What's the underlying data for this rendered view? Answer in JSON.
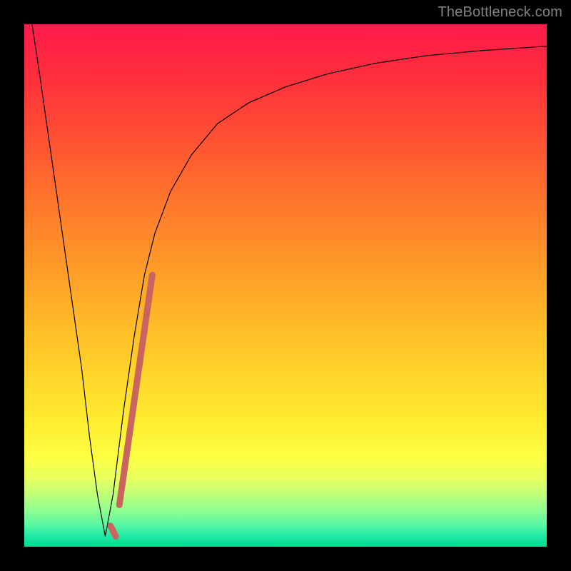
{
  "watermark": "TheBottleneck.com",
  "chart_data": {
    "type": "line",
    "title": "",
    "xlabel": "",
    "ylabel": "",
    "xlim": [
      0,
      100
    ],
    "ylim": [
      0,
      100
    ],
    "grid": false,
    "legend": false,
    "background_gradient": {
      "orientation": "vertical",
      "stops": [
        {
          "pos": 0.0,
          "color": "#ff1a4b"
        },
        {
          "pos": 0.08,
          "color": "#ff2a3f"
        },
        {
          "pos": 0.18,
          "color": "#ff4535"
        },
        {
          "pos": 0.3,
          "color": "#ff6a2d"
        },
        {
          "pos": 0.42,
          "color": "#ff8e29"
        },
        {
          "pos": 0.54,
          "color": "#ffb127"
        },
        {
          "pos": 0.66,
          "color": "#ffd22a"
        },
        {
          "pos": 0.76,
          "color": "#ffec2f"
        },
        {
          "pos": 0.83,
          "color": "#fdff43"
        },
        {
          "pos": 0.87,
          "color": "#e6ff5f"
        },
        {
          "pos": 0.9,
          "color": "#bfff79"
        },
        {
          "pos": 0.93,
          "color": "#8fff90"
        },
        {
          "pos": 0.96,
          "color": "#55f6a4"
        },
        {
          "pos": 0.98,
          "color": "#1de9a5"
        },
        {
          "pos": 1.0,
          "color": "#07d98e"
        }
      ]
    },
    "series": [
      {
        "name": "bottleneck-curve",
        "color": "#000000",
        "stroke_width": 1.2,
        "x": [
          1.5,
          3,
          5,
          7,
          9,
          11,
          12.5,
          14,
          15.5,
          17,
          19,
          21,
          23,
          25,
          28,
          32,
          37,
          43,
          50,
          58,
          67,
          77,
          88,
          100
        ],
        "y": [
          100,
          90,
          76,
          62,
          48,
          34,
          21,
          10,
          2,
          10,
          26,
          40,
          52,
          60,
          68,
          75,
          81,
          85,
          88,
          90.5,
          92.5,
          94,
          95,
          95.8
        ]
      },
      {
        "name": "highlight-segment",
        "color": "#c9645f",
        "stroke_width": 9,
        "linecap": "round",
        "segments": [
          {
            "x": [
              16.5,
              17.5
            ],
            "y": [
              4,
              2
            ]
          },
          {
            "x": [
              18.2,
              24.5
            ],
            "y": [
              8,
              52
            ]
          }
        ]
      }
    ]
  }
}
